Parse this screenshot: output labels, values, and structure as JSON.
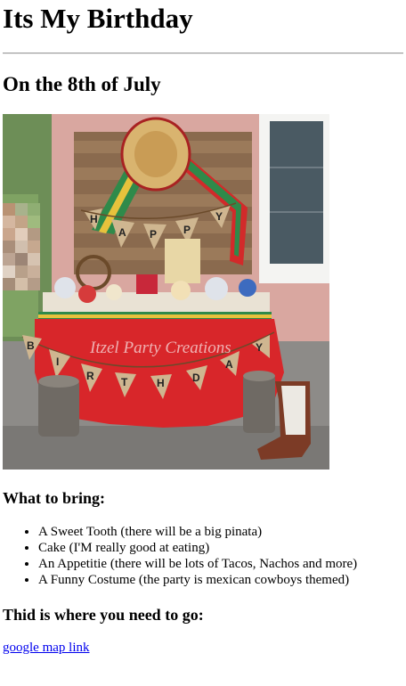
{
  "page": {
    "title": "Its My Birthday",
    "subtitle": "On the 8th of July"
  },
  "photo": {
    "watermark": "Itzel Party Creations",
    "banner_top": [
      "H",
      "A",
      "P",
      "P",
      "Y"
    ],
    "banner_bottom": [
      "B",
      "I",
      "R",
      "T",
      "H",
      "D",
      "A",
      "Y"
    ],
    "colors": {
      "wall": "#d9a7a0",
      "tablecloth": "#d8262a",
      "pavement": "#8d8b88",
      "burlap": "#cfb690",
      "sombrero": "#d9b46f"
    }
  },
  "bring": {
    "heading": "What to bring:",
    "items": [
      "A Sweet Tooth (there will be a big pinata)",
      "Cake (I'M really good at eating)",
      "An Appetitie (there will be lots of Tacos, Nachos and more)",
      "A Funny Costume (the party is mexican cowboys themed)"
    ]
  },
  "location": {
    "heading": "Thid is where you need to go:",
    "link_text": "google map link"
  }
}
